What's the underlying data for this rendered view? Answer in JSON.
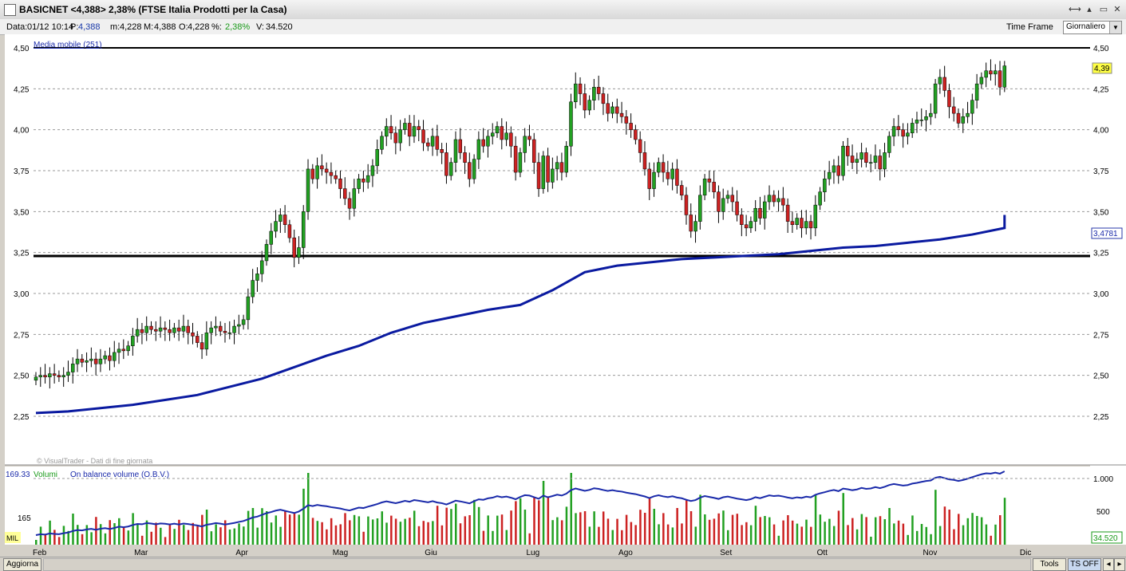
{
  "window": {
    "title": "BASICNET <4,388> 2,38% (FTSE Italia Prodotti per la Casa)",
    "buttons": [
      "⟷",
      "▴",
      "▭",
      "✕"
    ]
  },
  "info": {
    "data_label": "Data:",
    "data_value": "01/12 10:14",
    "price_label": "P:",
    "price_value": "4,388",
    "min_label": "m:",
    "min_value": "4,228",
    "max_label": "M:",
    "max_value": "4,388",
    "open_label": "O:",
    "open_value": "4,228",
    "change_label": "%:",
    "change_value": "2,38%",
    "volume_label": "V:",
    "volume_value": "34.520"
  },
  "timeframe": {
    "label": "Time Frame",
    "value": "Giornaliero"
  },
  "price_chart": {
    "indicator_label": "Media mobile (251)",
    "watermark": "© VisualTrader - Dati di fine giornata",
    "y_ticks": [
      "4,50",
      "4,25",
      "4,00",
      "3,75",
      "3,50",
      "3,25",
      "3,00",
      "2,75",
      "2,50",
      "2,25"
    ],
    "last_price_badge": "4,39",
    "ma_badge": "3,4781"
  },
  "volume_chart": {
    "left_value": "169.33",
    "volume_label": "Volumi",
    "obv_label": "On balance volume (O.B.V.)",
    "left_tick": "165",
    "unit_label": "MIL",
    "right_ticks": [
      "1.000",
      "500"
    ],
    "volume_badge": "34.520"
  },
  "x_axis": {
    "months": [
      "Feb",
      "Mar",
      "Apr",
      "Mag",
      "Giu",
      "Lug",
      "Ago",
      "Set",
      "Ott",
      "Nov",
      "Dic"
    ]
  },
  "status": {
    "refresh_label": "Aggiorna",
    "tools_label": "Tools",
    "ts_label": "TS OFF"
  },
  "colors": {
    "up": "#22a022",
    "down": "#cc2222",
    "ma": "#0a1aa0",
    "obv_up": "#1a2aaa",
    "obv_down": "#d06060",
    "bg": "#ffffff"
  },
  "chart_data": {
    "type": "candlestick",
    "ylim": [
      2.25,
      4.5
    ],
    "months": [
      "Feb",
      "Mar",
      "Apr",
      "Mag",
      "Giu",
      "Lug",
      "Ago",
      "Set",
      "Ott",
      "Nov",
      "Dic"
    ],
    "month_starts": [
      0,
      22,
      44,
      65,
      85,
      107,
      127,
      149,
      170,
      193,
      214
    ],
    "close": [
      2.49,
      2.5,
      2.49,
      2.51,
      2.5,
      2.49,
      2.5,
      2.52,
      2.57,
      2.6,
      2.58,
      2.59,
      2.6,
      2.57,
      2.6,
      2.62,
      2.59,
      2.64,
      2.66,
      2.65,
      2.68,
      2.74,
      2.78,
      2.76,
      2.8,
      2.78,
      2.77,
      2.79,
      2.78,
      2.76,
      2.79,
      2.77,
      2.8,
      2.76,
      2.74,
      2.7,
      2.66,
      2.76,
      2.79,
      2.8,
      2.77,
      2.76,
      2.76,
      2.8,
      2.81,
      2.84,
      2.98,
      3.08,
      3.12,
      3.2,
      3.3,
      3.38,
      3.44,
      3.48,
      3.42,
      3.34,
      3.22,
      3.28,
      3.5,
      3.76,
      3.7,
      3.78,
      3.76,
      3.74,
      3.72,
      3.7,
      3.64,
      3.58,
      3.52,
      3.64,
      3.7,
      3.68,
      3.72,
      3.78,
      3.88,
      3.96,
      4.02,
      3.98,
      3.92,
      4.0,
      4.04,
      3.96,
      4.02,
      4.0,
      3.92,
      3.9,
      3.96,
      3.88,
      3.86,
      3.72,
      3.8,
      3.94,
      3.86,
      3.8,
      3.7,
      3.82,
      3.94,
      3.9,
      3.96,
      3.98,
      4.02,
      3.94,
      3.98,
      3.9,
      3.74,
      3.86,
      3.96,
      3.94,
      3.8,
      3.64,
      3.84,
      3.68,
      3.76,
      3.8,
      3.74,
      3.9,
      4.17,
      4.28,
      4.22,
      4.12,
      4.18,
      4.26,
      4.22,
      4.16,
      4.1,
      4.14,
      4.1,
      4.08,
      4.04,
      4.0,
      3.94,
      3.86,
      3.76,
      3.64,
      3.74,
      3.8,
      3.74,
      3.7,
      3.76,
      3.66,
      3.6,
      3.48,
      3.38,
      3.44,
      3.6,
      3.7,
      3.68,
      3.62,
      3.5,
      3.58,
      3.6,
      3.56,
      3.48,
      3.42,
      3.4,
      3.44,
      3.52,
      3.46,
      3.56,
      3.6,
      3.56,
      3.58,
      3.54,
      3.44,
      3.42,
      3.46,
      3.4,
      3.44,
      3.4,
      3.54,
      3.62,
      3.7,
      3.74,
      3.78,
      3.72,
      3.9,
      3.84,
      3.8,
      3.82,
      3.86,
      3.8,
      3.8,
      3.84,
      3.76,
      3.86,
      3.96,
      4.02,
      4.0,
      3.96,
      3.98,
      4.04,
      4.06,
      4.06,
      4.08,
      4.1,
      4.28,
      4.32,
      4.24,
      4.14,
      4.1,
      4.04,
      4.08,
      4.1,
      4.18,
      4.28,
      4.32,
      4.36,
      4.34,
      4.36,
      4.26,
      4.39
    ],
    "ma": [
      2.27,
      2.28,
      2.3,
      2.32,
      2.35,
      2.38,
      2.43,
      2.48,
      2.55,
      2.62,
      2.68,
      2.76,
      2.82,
      2.86,
      2.9,
      2.93,
      3.02,
      3.13,
      3.17,
      3.19,
      3.21,
      3.22,
      3.23,
      3.24,
      3.26,
      3.28,
      3.29,
      3.31,
      3.33,
      3.36,
      3.4,
      3.44,
      3.48
    ],
    "ma_step": 7,
    "obv_label": "On balance volume (O.B.V.)"
  }
}
